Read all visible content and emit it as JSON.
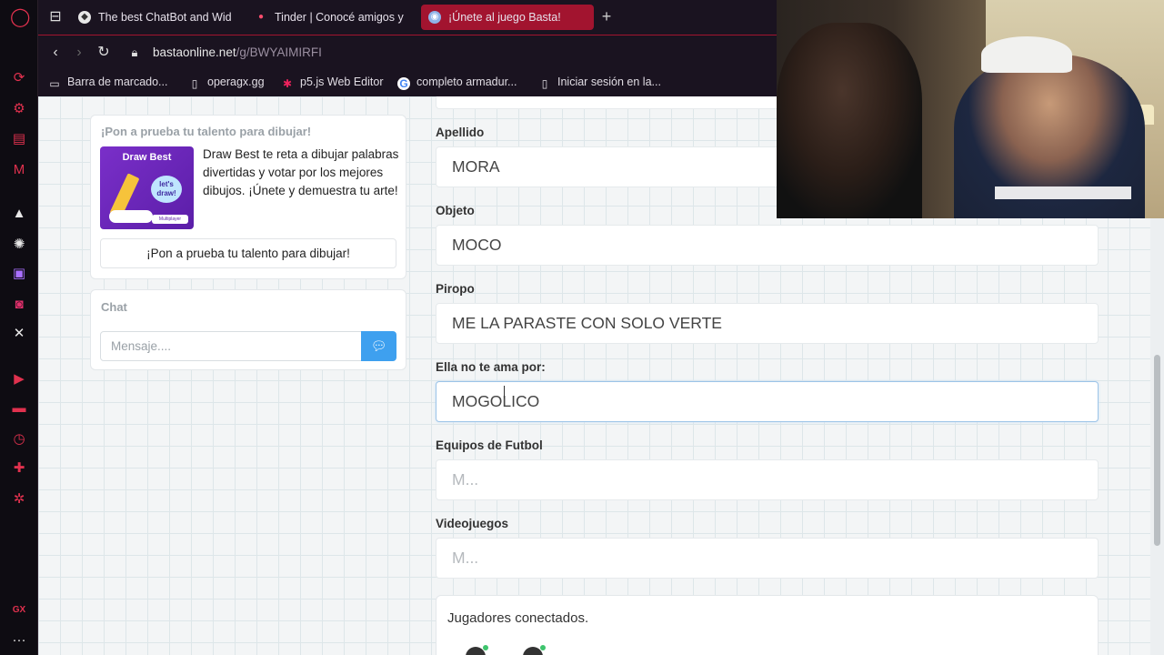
{
  "tabs": [
    {
      "label": "The best ChatBot and Wid",
      "icon": "chatbot-icon",
      "active": false
    },
    {
      "label": "Tinder | Conocé amigos y",
      "icon": "tinder-flame-icon",
      "active": false
    },
    {
      "label": "¡Únete al juego Basta!",
      "icon": "basta-globe-icon",
      "active": true
    }
  ],
  "address": {
    "domain": "bastaonline.net",
    "path": "/g/BWYAIMIRFI"
  },
  "bookmarks": [
    {
      "label": "Barra de marcado...",
      "icon": "folder-icon"
    },
    {
      "label": "operagx.gg",
      "icon": "page-icon"
    },
    {
      "label": "p5.js Web Editor",
      "icon": "star-icon"
    },
    {
      "label": "completo armadur...",
      "icon": "google-icon"
    },
    {
      "label": "Iniciar sesión en la...",
      "icon": "page-icon"
    }
  ],
  "promo": {
    "title": "¡Pon a prueba tu talento para dibujar!",
    "image_title": "Draw Best",
    "image_bubble": "let's draw!",
    "image_badge": "Multiplayer",
    "text": "Draw Best te reta a dibujar palabras divertidas y votar por los mejores dibujos. ¡Únete y demuestra tu arte!",
    "button": "¡Pon a prueba tu talento para dibujar!"
  },
  "chat": {
    "title": "Chat",
    "placeholder": "Mensaje...."
  },
  "fields": [
    {
      "label": "Apellido",
      "value": "MORA",
      "placeholder": false
    },
    {
      "label": "Objeto",
      "value": "MOCO",
      "placeholder": false
    },
    {
      "label": "Piropo",
      "value": "ME LA PARASTE CON SOLO VERTE",
      "placeholder": false
    },
    {
      "label": "Ella no te ama por:",
      "value": "MOGOLICO",
      "placeholder": false
    },
    {
      "label": "Equipos de Futbol",
      "value": "M...",
      "placeholder": true
    },
    {
      "label": "Videojuegos",
      "value": "M...",
      "placeholder": true
    }
  ],
  "players": {
    "title": "Jugadores conectados."
  },
  "colors": {
    "opera_red": "#a2142f",
    "send_blue": "#3ea0ef",
    "online_green": "#3ec46d"
  }
}
